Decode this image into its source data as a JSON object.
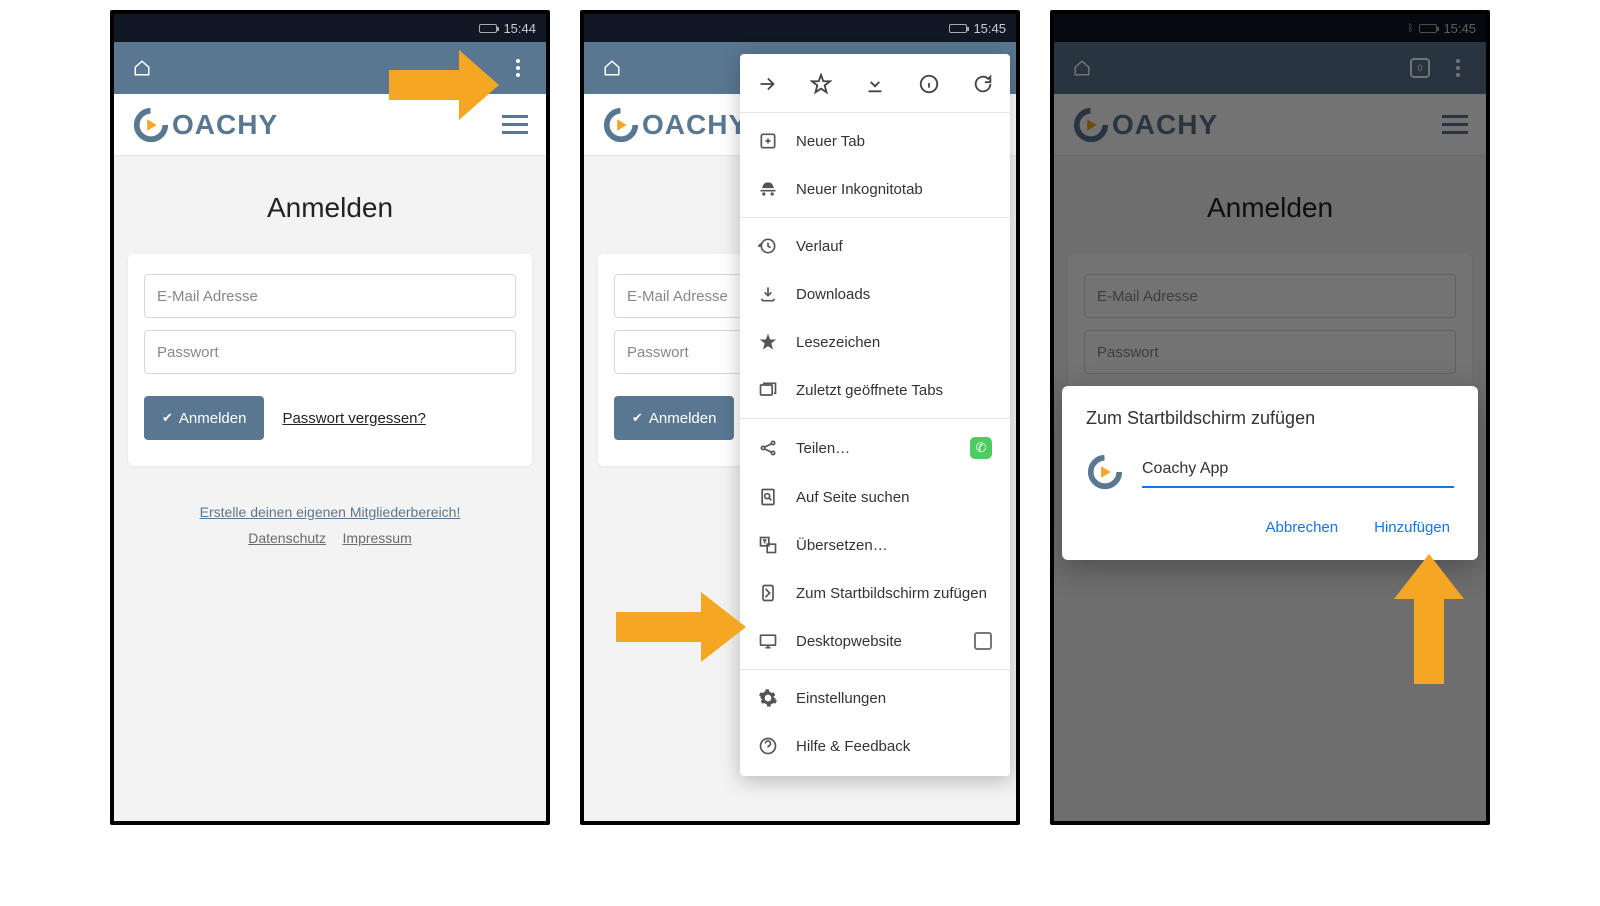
{
  "statusBar": {
    "time1": "15:44",
    "time2": "15:45",
    "time3": "15:45"
  },
  "app": {
    "brandPrefix": "C",
    "brandSuffix": "OACHY",
    "pageTitle": "Anmelden",
    "emailPlaceholder": "E-Mail Adresse",
    "passwordPlaceholder": "Passwort",
    "loginLabel": "Anmelden",
    "forgotLabel": "Passwort vergessen?",
    "ctaLink": "Erstelle deinen eigenen Mitgliederbereich!",
    "privacyLink": "Datenschutz",
    "imprintLink": "Impressum"
  },
  "chromeMenu": {
    "topIcons": [
      "forward",
      "star",
      "download",
      "info",
      "refresh"
    ],
    "items": [
      {
        "id": "new-tab",
        "label": "Neuer Tab"
      },
      {
        "id": "incognito",
        "label": "Neuer Inkognitotab"
      },
      {
        "id": "history",
        "label": "Verlauf",
        "sepBefore": true
      },
      {
        "id": "downloads",
        "label": "Downloads"
      },
      {
        "id": "bookmarks",
        "label": "Lesezeichen"
      },
      {
        "id": "recent-tabs",
        "label": "Zuletzt geöffnete Tabs"
      },
      {
        "id": "share",
        "label": "Teilen…",
        "whatsapp": true,
        "sepBefore": true
      },
      {
        "id": "find",
        "label": "Auf Seite suchen"
      },
      {
        "id": "translate",
        "label": "Übersetzen…"
      },
      {
        "id": "add-home",
        "label": "Zum Startbildschirm zufügen"
      },
      {
        "id": "desktop",
        "label": "Desktopwebsite",
        "checkbox": true
      },
      {
        "id": "settings",
        "label": "Einstellungen",
        "sepBefore": true
      },
      {
        "id": "help",
        "label": "Hilfe & Feedback"
      }
    ]
  },
  "dialog": {
    "title": "Zum Startbildschirm zufügen",
    "inputValue": "Coachy App",
    "cancel": "Abbrechen",
    "confirm": "Hinzufügen"
  },
  "tabCount": "0"
}
